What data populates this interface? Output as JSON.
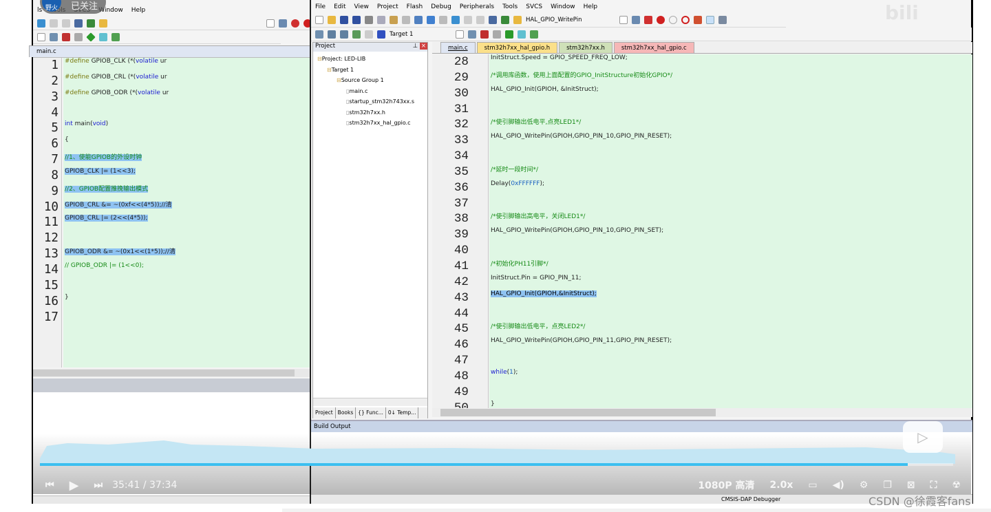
{
  "uploader": {
    "avatar_text": "野火",
    "follow_label": "已关注"
  },
  "left_window": {
    "menu": [
      "ls",
      "Tools",
      "SVCS",
      "Window",
      "Help"
    ],
    "active_tab": "main.c",
    "lines": [
      {
        "n": "1",
        "t": [
          [
            "pp",
            "#define"
          ],
          [
            "tx",
            " GPIOB_CLK (*("
          ],
          [
            "kw",
            "volatile"
          ],
          [
            "tx",
            " ur"
          ]
        ]
      },
      {
        "n": "2",
        "t": [
          [
            "pp",
            "#define"
          ],
          [
            "tx",
            " GPIOB_CRL (*("
          ],
          [
            "kw",
            "volatile"
          ],
          [
            "tx",
            " ur"
          ]
        ]
      },
      {
        "n": "3",
        "t": [
          [
            "pp",
            "#define"
          ],
          [
            "tx",
            " GPIOB_ODR (*("
          ],
          [
            "kw",
            "volatile"
          ],
          [
            "tx",
            " ur"
          ]
        ]
      },
      {
        "n": "4",
        "t": []
      },
      {
        "n": "5",
        "t": [
          [
            "kw",
            "int"
          ],
          [
            "tx",
            " main("
          ],
          [
            "kw",
            "void"
          ],
          [
            "tx",
            ")"
          ]
        ]
      },
      {
        "n": "6",
        "t": [
          [
            "tx",
            "{"
          ]
        ]
      },
      {
        "n": "7",
        "sel": true,
        "t": [
          [
            "cm",
            "  //1、使能GPIOB的外设时钟 "
          ]
        ]
      },
      {
        "n": "8",
        "sel": true,
        "t": [
          [
            "tx",
            "  GPIOB_CLK |= (1<<3); "
          ]
        ]
      },
      {
        "n": "9",
        "sel": true,
        "t": [
          [
            "cm",
            "  //2、GPIOB配置推挽输出模式 "
          ]
        ]
      },
      {
        "n": "10",
        "sel": true,
        "t": [
          [
            "tx",
            "  GPIOB_CRL &= ~(0xf<<(4*5));//清"
          ]
        ]
      },
      {
        "n": "11",
        "sel": true,
        "t": [
          [
            "tx",
            "  GPIOB_CRL |= (2<<(4*5)); "
          ]
        ]
      },
      {
        "n": "12",
        "sel": true,
        "t": [
          [
            "tx",
            "                           "
          ]
        ]
      },
      {
        "n": "13",
        "sel": true,
        "t": [
          [
            "tx",
            "  GPIOB_ODR &= ~(0x1<<(1*5));//清"
          ]
        ]
      },
      {
        "n": "14",
        "t": [
          [
            "cm",
            "//  GPIOB_ODR |= (1<<0);"
          ]
        ]
      },
      {
        "n": "15",
        "t": []
      },
      {
        "n": "16",
        "t": [
          [
            "tx",
            "}"
          ]
        ]
      },
      {
        "n": "17",
        "t": []
      }
    ]
  },
  "right_window": {
    "menu": [
      "File",
      "Edit",
      "View",
      "Project",
      "Flash",
      "Debug",
      "Peripherals",
      "Tools",
      "SVCS",
      "Window",
      "Help"
    ],
    "find_combo": "HAL_GPIO_WritePin",
    "target_combo": "Target 1",
    "project_panel": {
      "title": "Project",
      "tree": [
        {
          "label": "Project: LED-LIB",
          "depth": 0
        },
        {
          "label": "Target 1",
          "depth": 1
        },
        {
          "label": "Source Group 1",
          "depth": 2
        },
        {
          "label": "main.c",
          "depth": 3
        },
        {
          "label": "startup_stm32h743xx.s",
          "depth": 3
        },
        {
          "label": "stm32h7xx.h",
          "depth": 3
        },
        {
          "label": "stm32h7xx_hal_gpio.c",
          "depth": 3
        }
      ],
      "tabs": [
        "Project",
        "Books",
        "{} Func...",
        "0↓ Temp..."
      ]
    },
    "tabs": [
      {
        "label": "main.c",
        "color": "#dfe6f3"
      },
      {
        "label": "stm32h7xx_hal_gpio.h",
        "color": "#fbe08a"
      },
      {
        "label": "stm32h7xx.h",
        "color": "#cfe0b8"
      },
      {
        "label": "stm32h7xx_hal_gpio.c",
        "color": "#f6b7b7"
      }
    ],
    "lines": [
      {
        "n": "28",
        "t": [
          [
            "tx",
            "  InitStruct.Speed = GPIO_SPEED_FREQ_LOW;"
          ]
        ]
      },
      {
        "n": "29",
        "t": [
          [
            "cm",
            "  /*调用库函数，使用上面配置的GPIO_InitStructure初始化GPIO*/"
          ]
        ]
      },
      {
        "n": "30",
        "t": [
          [
            "tx",
            "  HAL_GPIO_Init(GPIOH, &InitStruct);"
          ]
        ]
      },
      {
        "n": "31",
        "t": []
      },
      {
        "n": "32",
        "t": [
          [
            "cm",
            "  /*使引脚输出低电平,点亮LED1*/"
          ]
        ]
      },
      {
        "n": "33",
        "t": [
          [
            "tx",
            "  HAL_GPIO_WritePin(GPIOH,GPIO_PIN_10,GPIO_PIN_RESET);"
          ]
        ]
      },
      {
        "n": "34",
        "t": []
      },
      {
        "n": "35",
        "t": [
          [
            "cm",
            "  /*延时一段时间*/"
          ]
        ]
      },
      {
        "n": "36",
        "t": [
          [
            "tx",
            "  Delay("
          ],
          [
            "nm",
            "0xFFFFFF"
          ],
          [
            "tx",
            ");"
          ]
        ]
      },
      {
        "n": "37",
        "t": []
      },
      {
        "n": "38",
        "t": [
          [
            "cm",
            "  /*使引脚输出高电平，关闭LED1*/"
          ]
        ]
      },
      {
        "n": "39",
        "t": [
          [
            "tx",
            "  HAL_GPIO_WritePin(GPIOH,GPIO_PIN_10,GPIO_PIN_SET);"
          ]
        ]
      },
      {
        "n": "40",
        "t": []
      },
      {
        "n": "41",
        "t": [
          [
            "cm",
            "  /*初始化PH11引脚*/"
          ]
        ]
      },
      {
        "n": "42",
        "t": [
          [
            "tx",
            "  InitStruct.Pin = GPIO_PIN_11;"
          ]
        ]
      },
      {
        "n": "43",
        "selpart": true,
        "t": [
          [
            "tx",
            "  "
          ],
          [
            "sel",
            "HAL_GPIO_Init(GPIOH,&InitStruct);"
          ]
        ]
      },
      {
        "n": "44",
        "t": []
      },
      {
        "n": "45",
        "t": [
          [
            "cm",
            "  /*使引脚输出低电平，点亮LED2*/"
          ]
        ]
      },
      {
        "n": "46",
        "t": [
          [
            "tx",
            "  HAL_GPIO_WritePin(GPIOH,GPIO_PIN_11,GPIO_PIN_RESET);"
          ]
        ]
      },
      {
        "n": "47",
        "t": []
      },
      {
        "n": "48",
        "t": [
          [
            "kw",
            "  while"
          ],
          [
            "tx",
            "("
          ],
          [
            "nm",
            "1"
          ],
          [
            "tx",
            ");"
          ]
        ]
      },
      {
        "n": "49",
        "t": []
      },
      {
        "n": "50",
        "t": [
          [
            "tx",
            "}"
          ]
        ]
      }
    ],
    "build_output_title": "Build Output",
    "status_debugger": "CMSIS-DAP Debugger"
  },
  "player": {
    "time": "35:41 / 37:34",
    "quality": "1080P 高清",
    "speed": "2.0x",
    "progress_percent": 95,
    "accent": "#3bbff0"
  },
  "watermark": "CSDN @徐霞客fans"
}
